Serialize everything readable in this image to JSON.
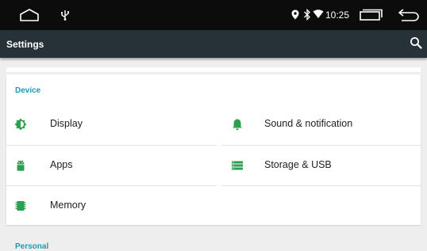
{
  "status_bar": {
    "time": "10:25",
    "icons": [
      "home-icon",
      "usb-icon",
      "location-icon",
      "bluetooth-icon",
      "wifi-icon",
      "recent-apps-icon",
      "back-icon"
    ]
  },
  "toolbar": {
    "title": "Settings",
    "search_icon": "search-icon"
  },
  "sections": {
    "device": {
      "title": "Device"
    },
    "personal": {
      "title": "Personal"
    }
  },
  "tiles": {
    "display": {
      "label": "Display",
      "icon": "brightness-icon"
    },
    "sound": {
      "label": "Sound & notification",
      "icon": "bell-icon"
    },
    "apps": {
      "label": "Apps",
      "icon": "android-icon"
    },
    "storage": {
      "label": "Storage & USB",
      "icon": "storage-icon"
    },
    "memory": {
      "label": "Memory",
      "icon": "memory-chip-icon"
    }
  },
  "colors": {
    "accent": "#1e9bb0",
    "icon_green": "#2e9e51",
    "toolbar": "#263238",
    "status_bar": "#0c0c0c",
    "background": "#eeeeee"
  }
}
